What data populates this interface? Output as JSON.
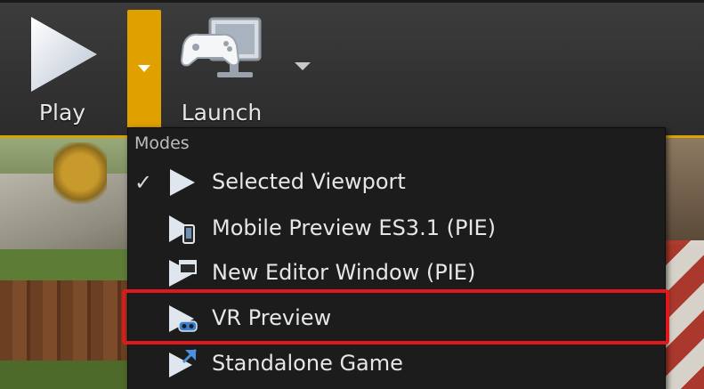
{
  "toolbar": {
    "play_label": "Play",
    "launch_label": "Launch",
    "accent_color": "#e0a000"
  },
  "menu": {
    "header": "Modes",
    "items": [
      {
        "label": "Selected Viewport",
        "checked": true,
        "icon": "play-triangle-icon"
      },
      {
        "label": "Mobile Preview ES3.1 (PIE)",
        "checked": false,
        "icon": "mobile-preview-icon"
      },
      {
        "label": "New Editor Window (PIE)",
        "checked": false,
        "icon": "new-window-icon"
      },
      {
        "label": "VR Preview",
        "checked": false,
        "icon": "vr-headset-icon"
      },
      {
        "label": "Standalone Game",
        "checked": false,
        "icon": "standalone-game-icon"
      }
    ],
    "check_glyph": "✓",
    "highlight_color": "#e0181b"
  }
}
